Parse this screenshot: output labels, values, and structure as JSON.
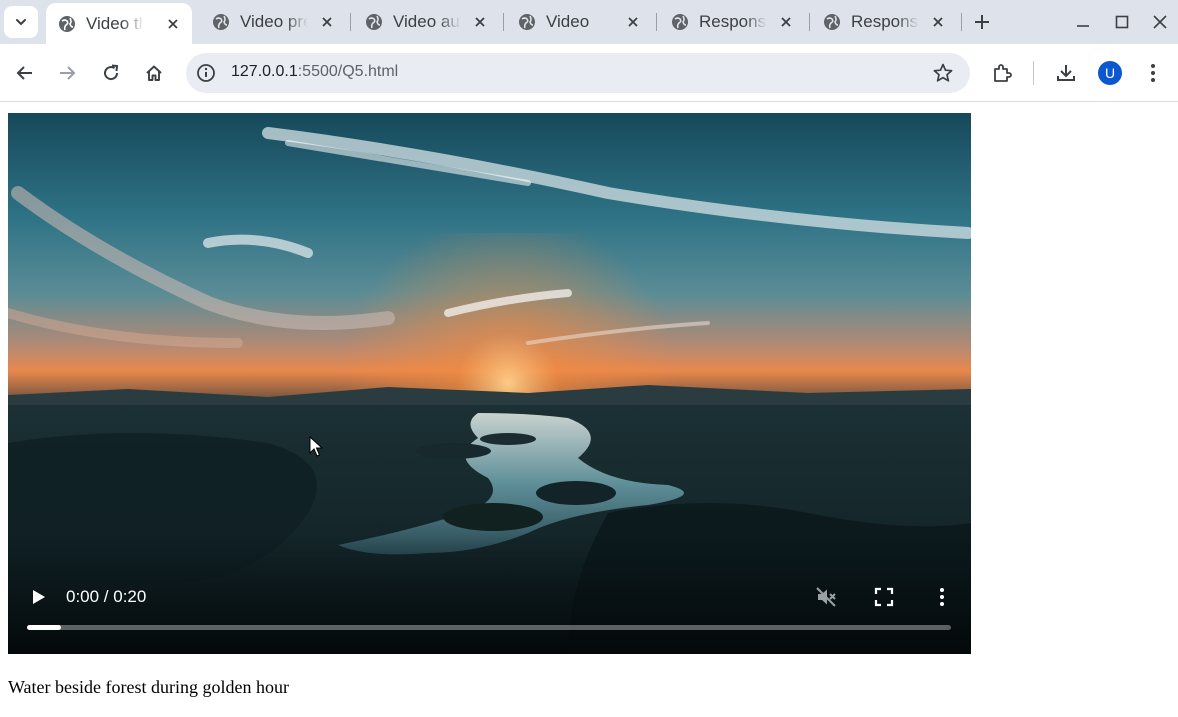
{
  "browser": {
    "tabs": [
      {
        "title": "Video that autoplays",
        "active": true
      },
      {
        "title": "Video preload",
        "active": false
      },
      {
        "title": "Video autoplay",
        "active": false
      },
      {
        "title": "Video",
        "active": false
      },
      {
        "title": "Responsive video",
        "active": false
      },
      {
        "title": "Responsive video",
        "active": false
      }
    ],
    "address": {
      "host": "127.0.0.1",
      "path": ":5500/Q5.html"
    },
    "profile_initial": "U"
  },
  "video": {
    "time_display": "0:00 / 0:20",
    "muted": true,
    "buffered_fraction": 0.037
  },
  "caption": "Water beside forest during golden hour",
  "colors": {
    "tabstrip_bg": "#dee3eb",
    "omnibox_bg": "#e9edf3",
    "avatar_bg": "#0b57d0"
  },
  "icons": {
    "tab_favicon": "globe-icon",
    "toolbar": [
      "back-icon",
      "forward-icon",
      "reload-icon",
      "home-icon",
      "info-icon",
      "star-icon",
      "extensions-icon",
      "download-icon",
      "more-icon"
    ]
  }
}
